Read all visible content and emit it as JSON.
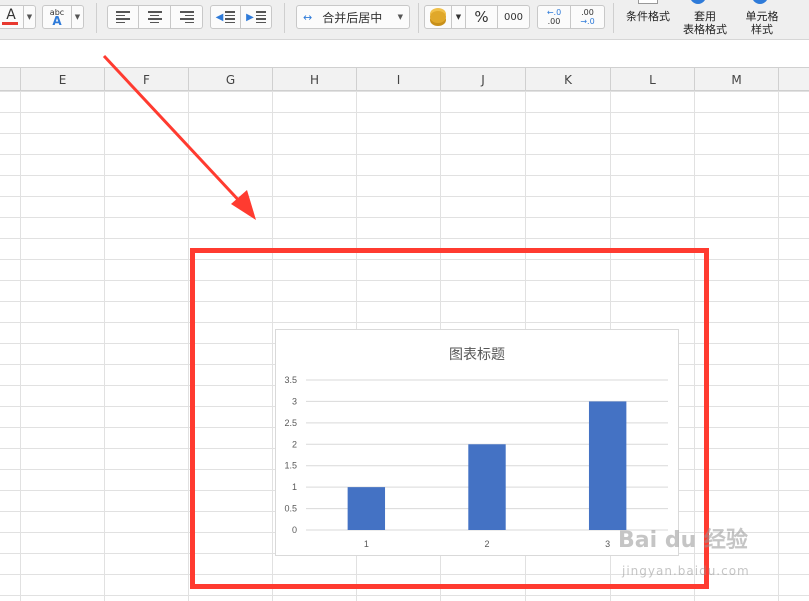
{
  "toolbar": {
    "font_color_label": "A",
    "spellcheck_label_top": "abc",
    "spellcheck_label_bottom": "A",
    "merge_center_label": "合并后居中",
    "percent_label": "%",
    "thousands_label": "000",
    "inc_decimal_top": "←.0",
    "inc_decimal_bottom": ".00",
    "dec_decimal_top": ".00",
    "dec_decimal_bottom": "→.0",
    "conditional_format_label": "条件格式",
    "table_style_line1": "套用",
    "table_style_line2": "表格格式",
    "cell_style_line1": "单元格",
    "cell_style_line2": "样式",
    "accent_red": "#e8392f",
    "accent_blue": "#2f7bd9"
  },
  "columns": [
    "E",
    "F",
    "G",
    "H",
    "I",
    "J",
    "K",
    "L",
    "M"
  ],
  "chart_data": {
    "type": "bar",
    "title": "图表标题",
    "categories": [
      "1",
      "2",
      "3"
    ],
    "series": [
      {
        "values": [
          1,
          2,
          3
        ],
        "color": "#4472c4"
      }
    ],
    "ylim": [
      0,
      3.5
    ],
    "yticks": [
      "0",
      "0.5",
      "1",
      "1.5",
      "2",
      "2.5",
      "3",
      "3.5"
    ],
    "grid": true,
    "legend": "none"
  },
  "annotation": {
    "highlight_color": "#ff3b30"
  },
  "watermark": {
    "brand": "Bai du 经验",
    "url": "jingyan.baidu.com"
  }
}
